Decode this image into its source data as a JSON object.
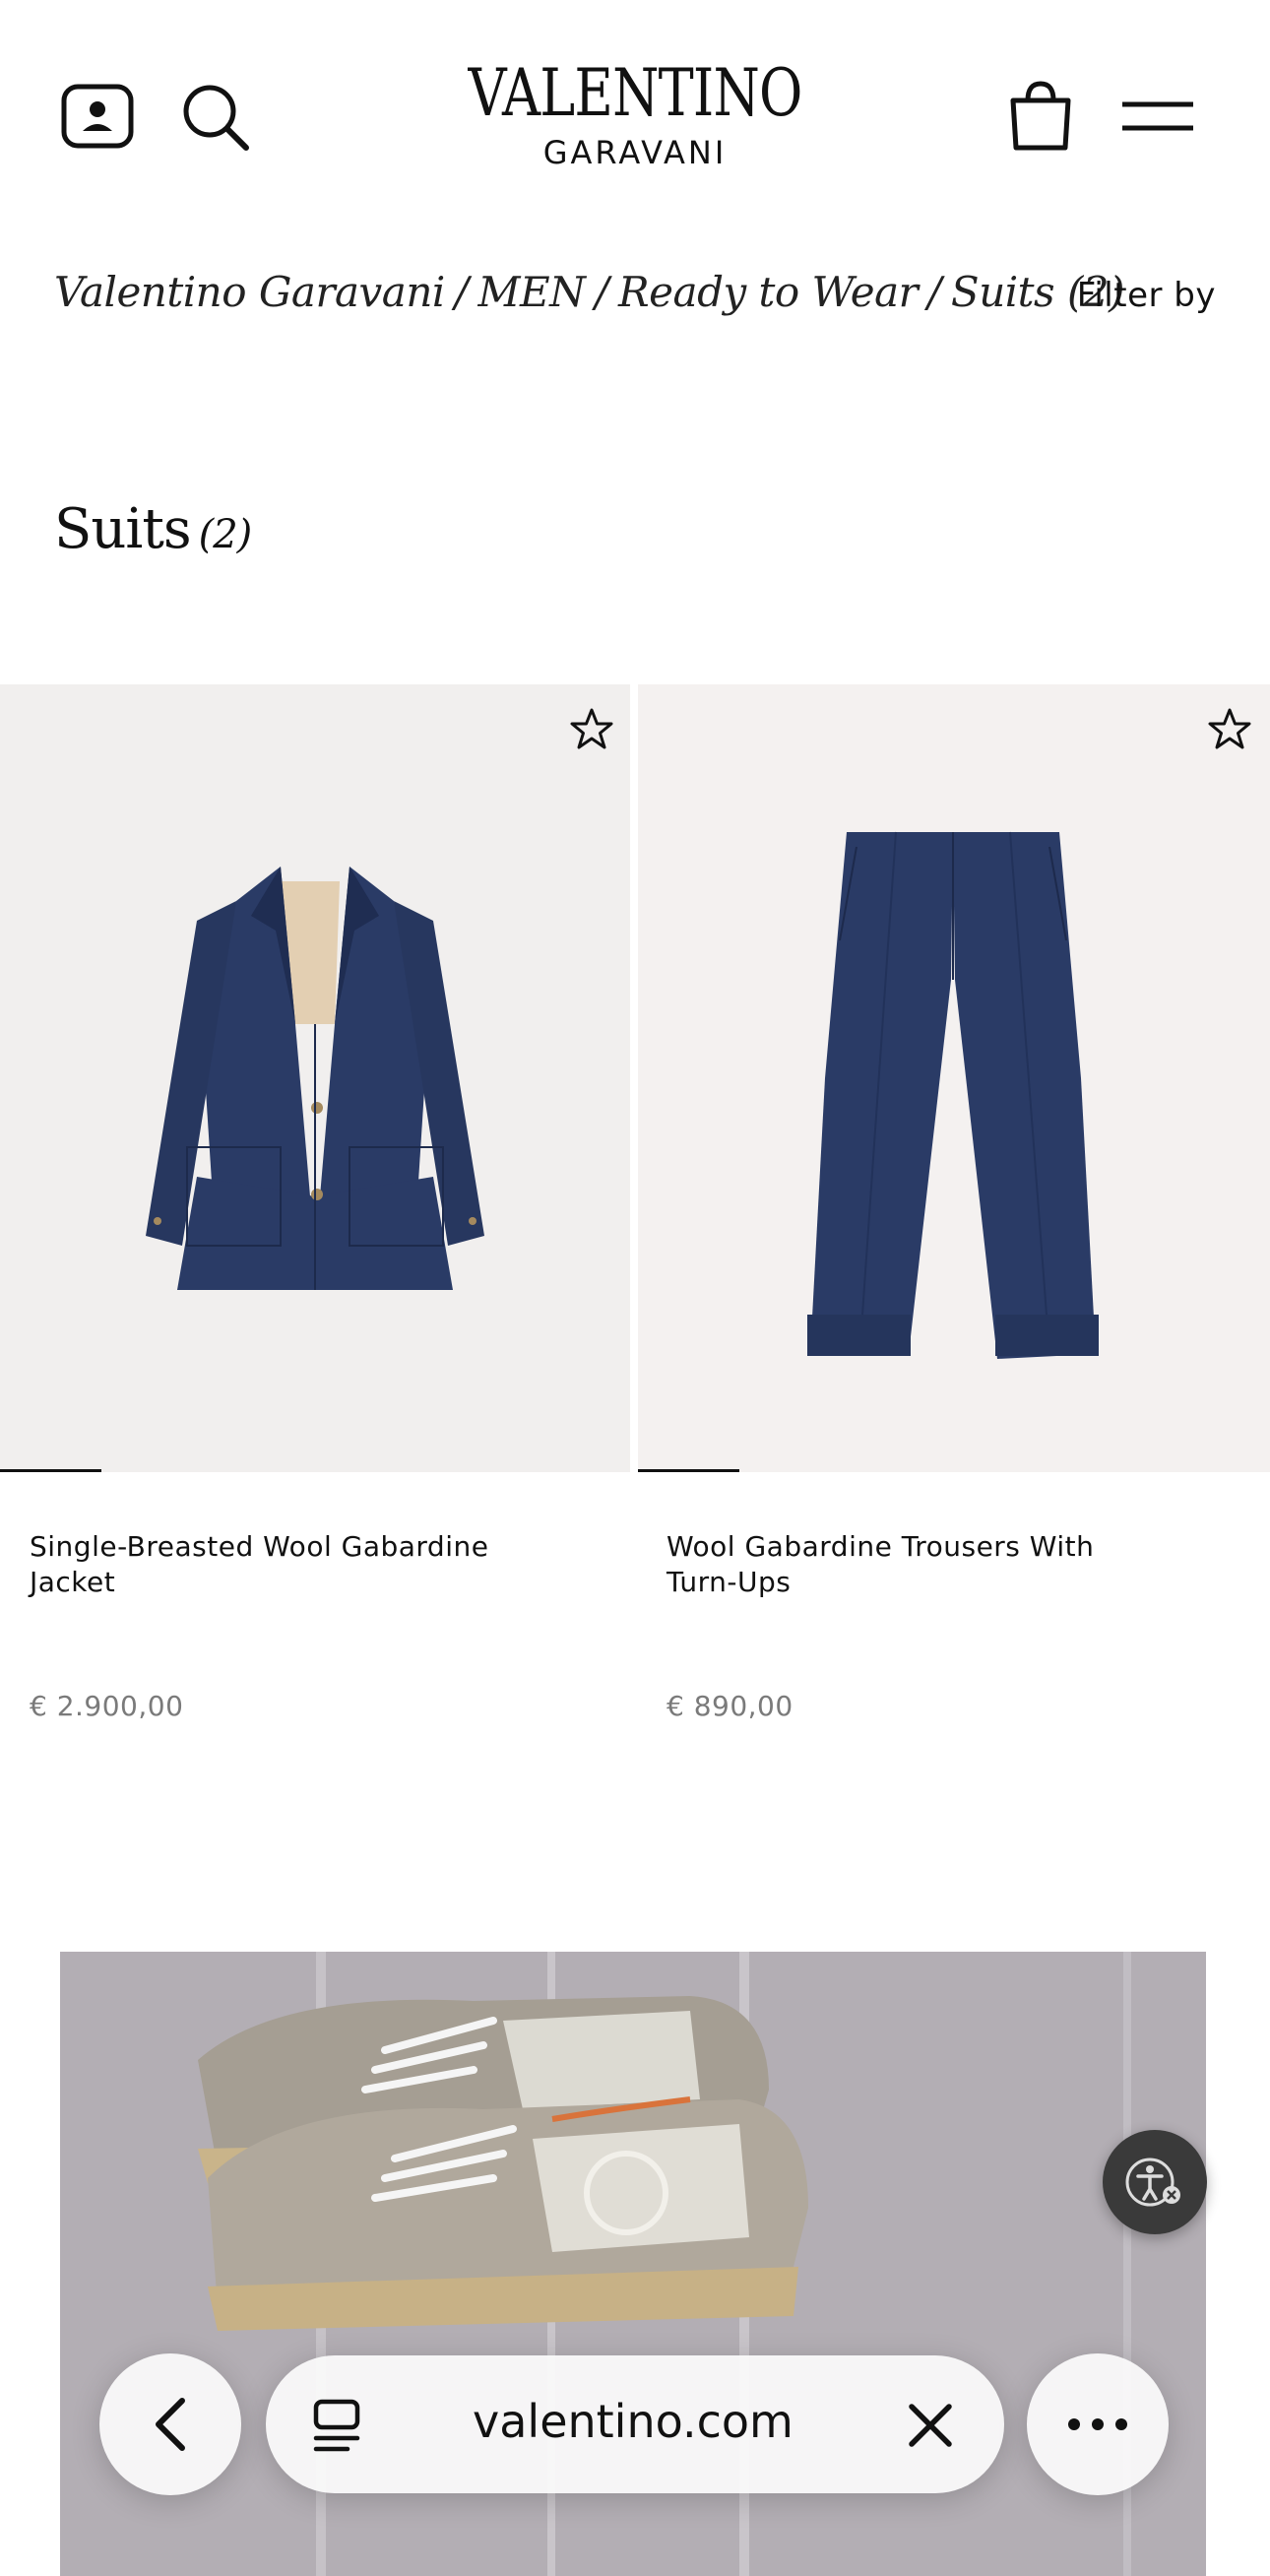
{
  "header": {
    "logo_main": "VALENTINO",
    "logo_sub": "GARAVANI",
    "icons": [
      "account-icon",
      "search-icon",
      "shopping-bag-icon",
      "menu-icon"
    ]
  },
  "breadcrumb": {
    "items": [
      "Valentino Garavani",
      "MEN",
      "Ready to Wear",
      "Suits (2)"
    ],
    "filter_label": "Filter by"
  },
  "page": {
    "title": "Suits",
    "count": "(2)"
  },
  "products": [
    {
      "name": "Single-Breasted Wool Gabardine Jacket",
      "price": "€ 2.900,00",
      "wishlist_icon": "star-outline-icon",
      "image_progress": 0.16
    },
    {
      "name": "Wool Gabardine Trousers With Turn-Ups",
      "price": "€ 890,00",
      "wishlist_icon": "star-outline-icon",
      "image_progress": 0.16
    }
  ],
  "browser": {
    "url": "valentino.com",
    "icons": [
      "back-icon",
      "tabs-icon",
      "close-icon",
      "more-icon"
    ]
  },
  "colors": {
    "navy": "#2a3b66",
    "text": "#111111",
    "price": "#7a7a7a",
    "card_bg": "#f1efee"
  }
}
